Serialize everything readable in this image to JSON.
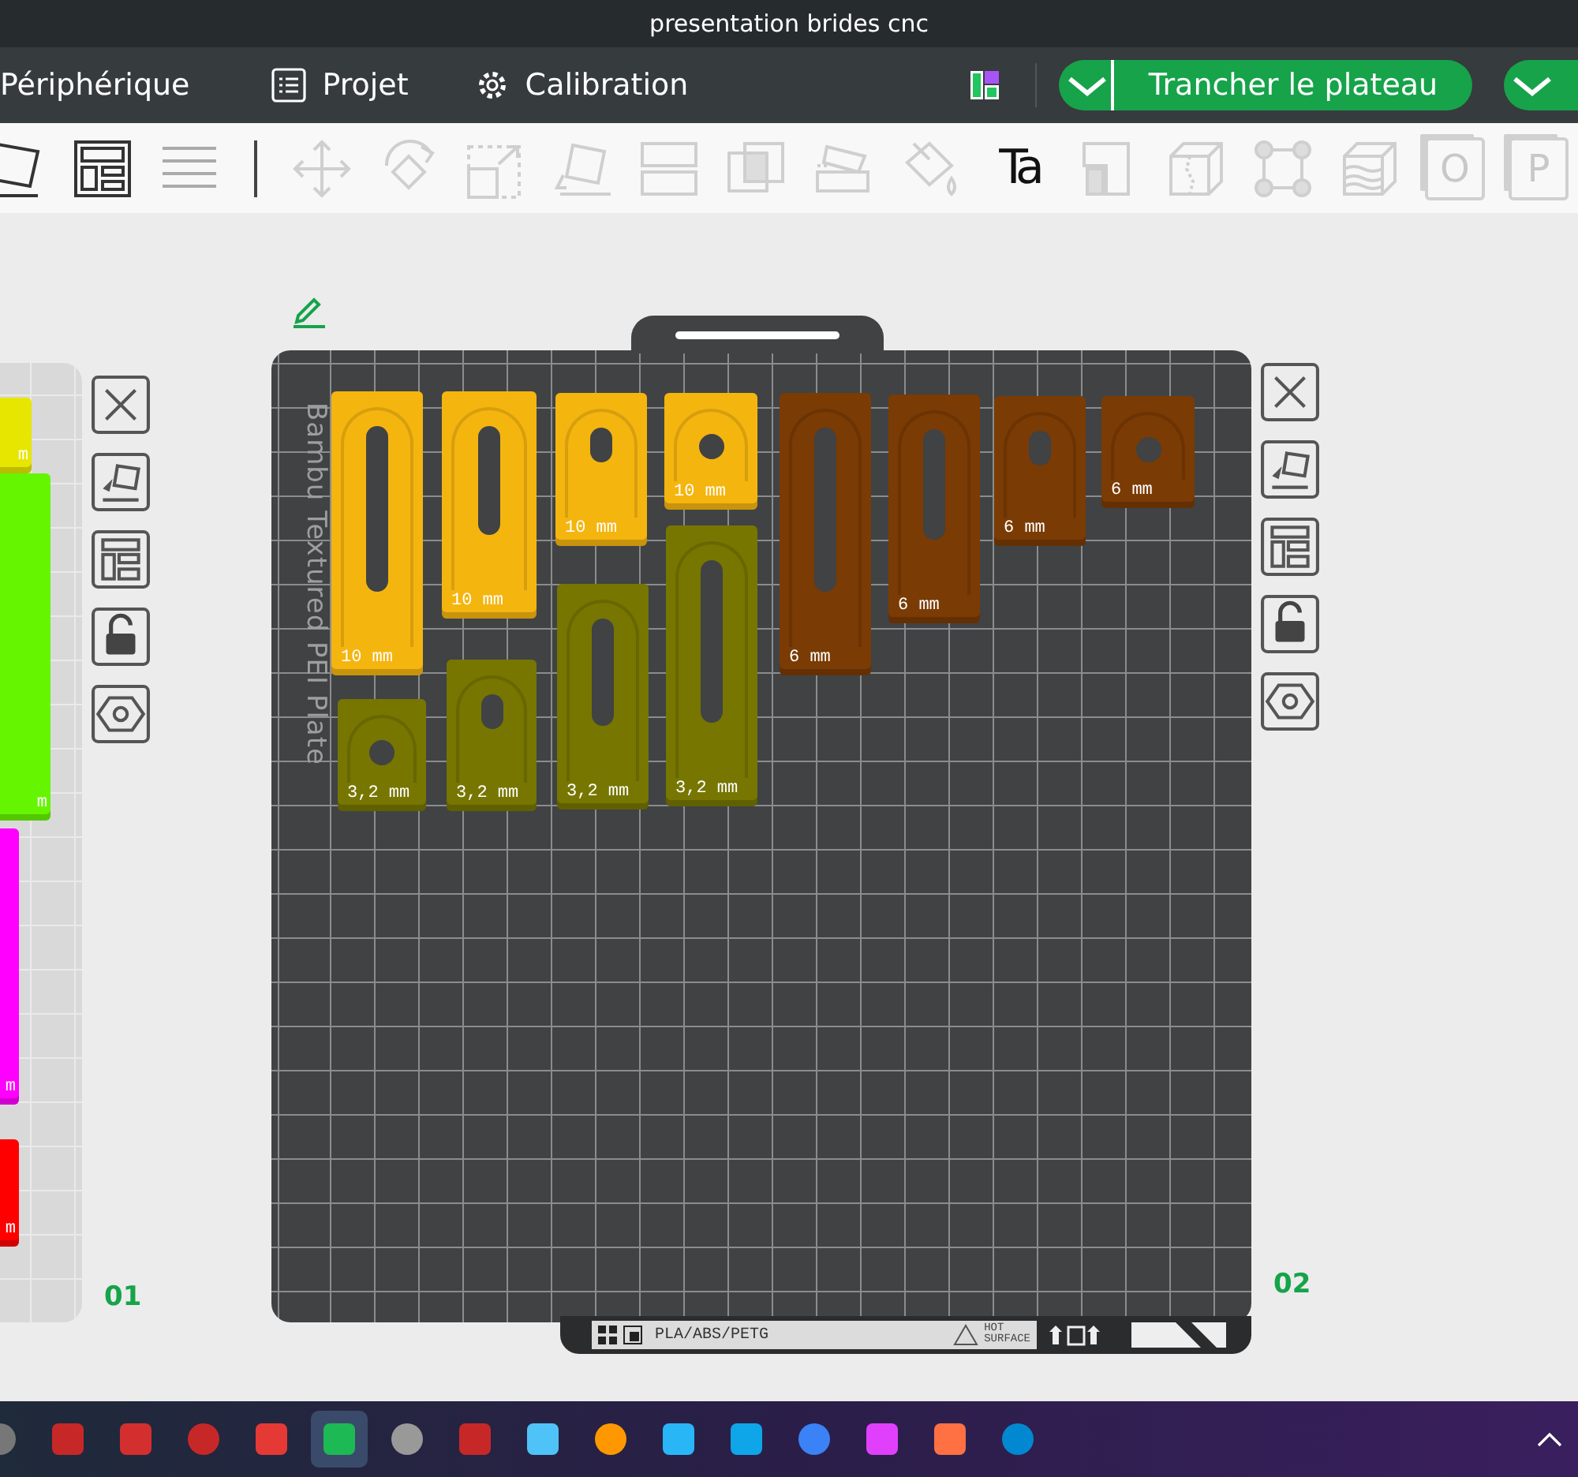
{
  "window": {
    "title": "presentation brides cnc"
  },
  "menu_tabs": [
    {
      "label": "Périphérique",
      "kind": "plain"
    },
    {
      "label": "Projet",
      "kind": "project"
    },
    {
      "label": "Calibration",
      "kind": "calibration"
    }
  ],
  "slice_button": {
    "label": "Trancher le plateau"
  },
  "toolbar": {
    "text_icon_label": "Ta",
    "page_icon_labels": [
      "O",
      "P"
    ]
  },
  "plates": [
    {
      "number": "01",
      "selected": false,
      "parts": [
        {
          "kind": "block",
          "color": "#e6e600",
          "label": "m"
        },
        {
          "kind": "block",
          "color": "#66f500",
          "label": "m"
        },
        {
          "kind": "block",
          "color": "#ff00ff",
          "label": "m"
        },
        {
          "kind": "block",
          "color": "#ff0000",
          "label": "m"
        }
      ]
    },
    {
      "number": "02",
      "selected": true,
      "plate_name": "Bambu Textured PEI Plate",
      "bed_material": "PLA/ABS/PETG",
      "bed_warning": [
        "HOT",
        "SURFACE"
      ],
      "parts": [
        {
          "kind": "slot",
          "color": "#f5b50f",
          "label": "10 mm"
        },
        {
          "kind": "slot",
          "color": "#f5b50f",
          "label": "10 mm"
        },
        {
          "kind": "slot",
          "color": "#f5b50f",
          "label": "10 mm"
        },
        {
          "kind": "round",
          "color": "#f5b50f",
          "label": "10 mm"
        },
        {
          "kind": "slot",
          "color": "#7a3b04",
          "label": "6 mm"
        },
        {
          "kind": "slot",
          "color": "#7a3b04",
          "label": "6 mm"
        },
        {
          "kind": "slot",
          "color": "#7a3b04",
          "label": "6 mm"
        },
        {
          "kind": "round",
          "color": "#7a3b04",
          "label": "6 mm"
        },
        {
          "kind": "round",
          "color": "#767600",
          "label": "3,2 mm"
        },
        {
          "kind": "slot",
          "color": "#767600",
          "label": "3,2 mm"
        },
        {
          "kind": "slot",
          "color": "#767600",
          "label": "3,2 mm"
        },
        {
          "kind": "slot",
          "color": "#767600",
          "label": "3,2 mm"
        }
      ]
    }
  ],
  "taskbar": {
    "apps": [
      {
        "selected": false
      },
      {
        "selected": false
      },
      {
        "selected": false
      },
      {
        "selected": false
      },
      {
        "selected": false
      },
      {
        "selected": true
      },
      {
        "selected": false
      },
      {
        "selected": false
      },
      {
        "selected": false
      },
      {
        "selected": false
      },
      {
        "selected": false
      },
      {
        "selected": false
      },
      {
        "selected": false
      },
      {
        "selected": false
      },
      {
        "selected": false
      },
      {
        "selected": false
      }
    ]
  }
}
